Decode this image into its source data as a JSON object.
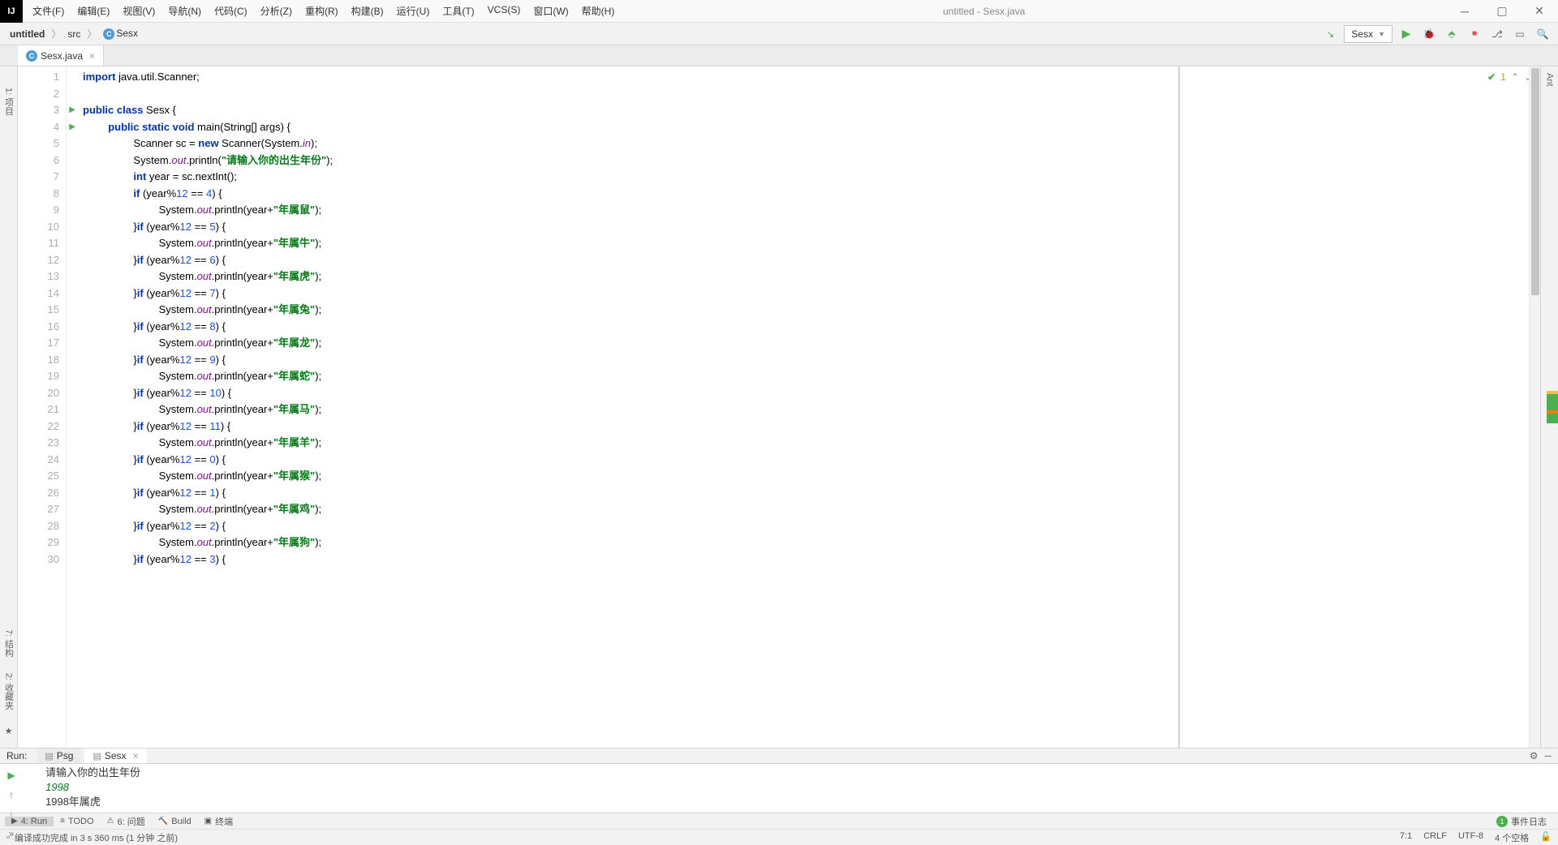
{
  "window_title": "untitled - Sesx.java",
  "menu": [
    "文件(F)",
    "编辑(E)",
    "视图(V)",
    "导航(N)",
    "代码(C)",
    "分析(Z)",
    "重构(R)",
    "构建(B)",
    "运行(U)",
    "工具(T)",
    "VCS(S)",
    "窗口(W)",
    "帮助(H)"
  ],
  "breadcrumb": {
    "project": "untitled",
    "folder": "src",
    "file": "Sesx"
  },
  "run_config": "Sesx",
  "tab_name": "Sesx.java",
  "analysis": {
    "warnings": "1"
  },
  "gutter_lines": [
    "1",
    "2",
    "3",
    "4",
    "5",
    "6",
    "7",
    "8",
    "9",
    "10",
    "11",
    "12",
    "13",
    "14",
    "15",
    "16",
    "17",
    "18",
    "19",
    "20",
    "21",
    "22",
    "23",
    "24",
    "25",
    "26",
    "27",
    "28",
    "29",
    "30"
  ],
  "code": {
    "l1a": "import",
    "l1b": " java.util.Scanner;",
    "l3": "public class ",
    "l3b": "Sesx {",
    "l4": "public static void ",
    "l4b": "main(String[] args) {",
    "l5a": "Scanner sc = ",
    "l5b": "new",
    "l5c": " Scanner(System.",
    "l5d": "in",
    "l5e": ");",
    "l6a": "System.",
    "l6b": "out",
    "l6c": ".println(",
    "l6d": "\"请输入你的出生年份\"",
    "l6e": ");",
    "l7a": "int",
    "l7b": " year = sc.nextInt();",
    "l8a": "if",
    "l8b": " (year%",
    "l8c": "12",
    "l8d": " == ",
    "l8e": "4",
    "l8f": ") {",
    "l9a": "System.",
    "l9b": "out",
    "l9c": ".println(year+",
    "l9d": "\"年属鼠\"",
    "l9e": ");",
    "l10a": "}",
    "l10b": "if",
    "l10c": " (year%",
    "l10d": "12",
    "l10e": " == ",
    "l10f": "5",
    "l10g": ") {",
    "l11d": "\"年属牛\"",
    "l12f": "6",
    "l13d": "\"年属虎\"",
    "l14f": "7",
    "l15d": "\"年属兔\"",
    "l16f": "8",
    "l17d": "\"年属龙\"",
    "l18f": "9",
    "l19d": "\"年属蛇\"",
    "l20f": "10",
    "l21d": "\"年属马\"",
    "l22f": "11",
    "l23d": "\"年属羊\"",
    "l24f": "0",
    "l25d": "\"年属猴\"",
    "l26f": "1",
    "l27d": "\"年属鸡\"",
    "l28f": "2",
    "l29d": "\"年属狗\"",
    "l30f": "3"
  },
  "run_panel": {
    "title": "Run:",
    "tabs": [
      {
        "label": "Psg"
      },
      {
        "label": "Sesx"
      }
    ]
  },
  "console": {
    "line1": "请输入你的出生年份",
    "line2": "1998",
    "line3": "1998年属虎"
  },
  "bottom_tools": {
    "run": "4: Run",
    "todo": "TODO",
    "problems": "6: 问题",
    "build": "Build",
    "terminal": "终端",
    "events": "事件日志"
  },
  "status": {
    "msg": "编译成功完成 in 3 s 360 ms (1 分钟 之前)",
    "pos": "7:1",
    "eol": "CRLF",
    "enc": "UTF-8",
    "indent": "4 个空格"
  },
  "left_tools": {
    "proj": "1: 项目",
    "struct": "7: 结构",
    "fav": "2: 收藏夹"
  },
  "right_tools": {
    "ant": "Ant"
  }
}
